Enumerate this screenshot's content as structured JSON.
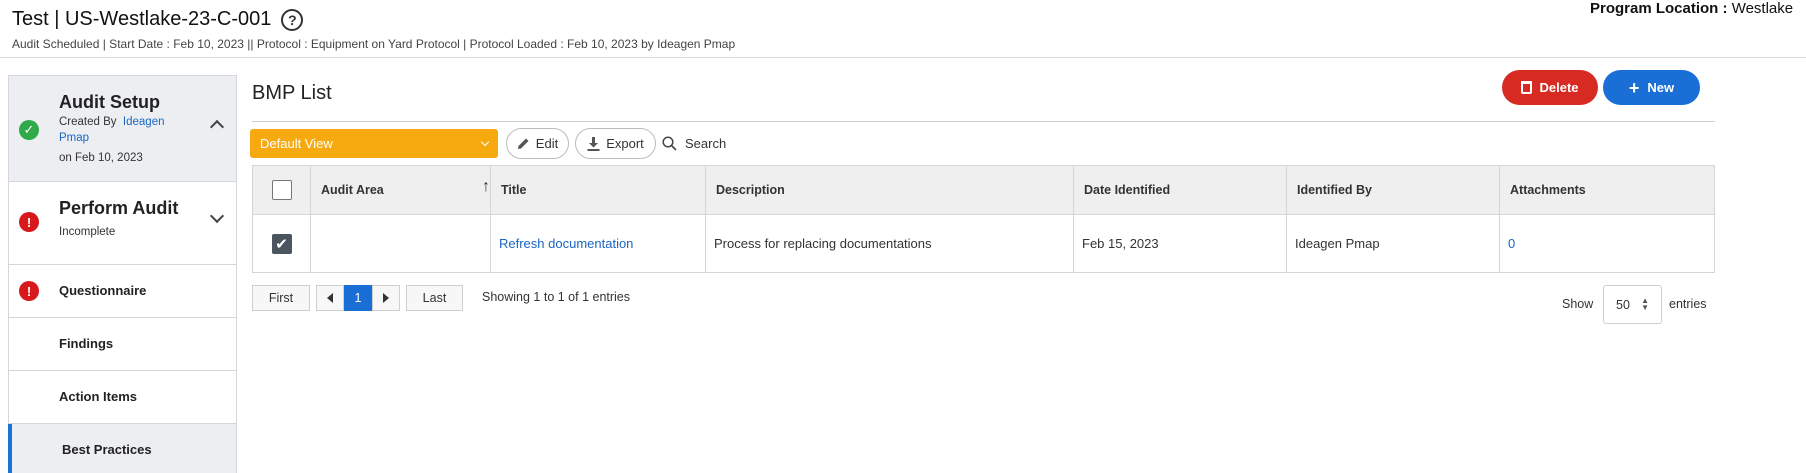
{
  "header": {
    "title": "Test | US-Westlake-23-C-001",
    "subtitle": "Audit Scheduled | Start Date : Feb 10, 2023 || Protocol : Equipment on Yard Protocol | Protocol Loaded : Feb 10, 2023 by Ideagen Pmap",
    "help_icon": "?",
    "program_location_label": "Program Location :",
    "program_location_value": "Westlake"
  },
  "sidebar": {
    "audit_setup": {
      "title": "Audit Setup",
      "created_by_label": "Created By",
      "created_by_name_1": "Ideagen",
      "created_by_name_2": "Pmap",
      "created_on": "on Feb 10, 2023",
      "status": "complete"
    },
    "perform_audit": {
      "title": "Perform Audit",
      "status_text": "Incomplete",
      "status": "error"
    },
    "items": [
      {
        "label": "Questionnaire",
        "status": "error"
      },
      {
        "label": "Findings"
      },
      {
        "label": "Action Items"
      },
      {
        "label": "Best Practices",
        "active": true
      }
    ]
  },
  "main": {
    "title": "BMP List",
    "delete_label": "Delete",
    "new_label": "New",
    "toolbar": {
      "view_label": "Default View",
      "edit_label": "Edit",
      "export_label": "Export",
      "search_label": "Search"
    },
    "table": {
      "columns": [
        "Audit Area",
        "Title",
        "Description",
        "Date Identified",
        "Identified By",
        "Attachments"
      ],
      "rows": [
        {
          "checked": true,
          "audit_area": "",
          "title": "Refresh documentation",
          "description": "Process for replacing documentations",
          "date_identified": "Feb 15, 2023",
          "identified_by": "Ideagen Pmap",
          "attachments": "0"
        }
      ]
    },
    "pagination": {
      "first": "First",
      "current_page": "1",
      "last": "Last",
      "showing": "Showing 1 to 1 of 1 entries",
      "show_label": "Show",
      "page_size": "50",
      "entries_label": "entries"
    }
  },
  "colors": {
    "primary": "#1a6fd6",
    "danger": "#d62a22",
    "warning": "#f6aa0f",
    "success": "#2eaa4a"
  }
}
